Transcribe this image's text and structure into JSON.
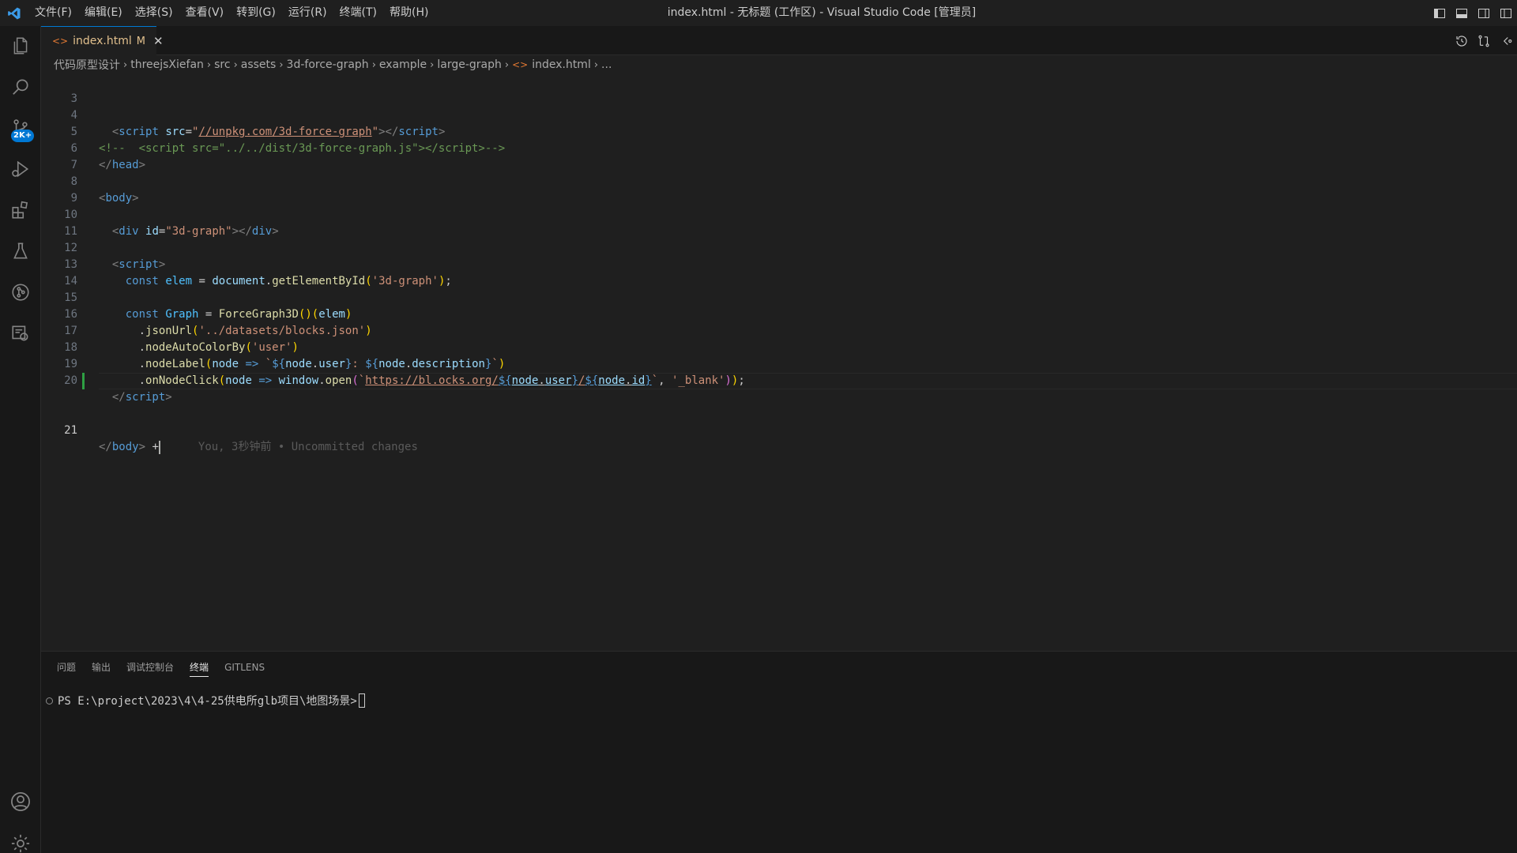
{
  "window": {
    "title": "index.html - 无标题 (工作区) - Visual Studio Code [管理员]"
  },
  "menu": [
    "文件(F)",
    "编辑(E)",
    "选择(S)",
    "查看(V)",
    "转到(G)",
    "运行(R)",
    "终端(T)",
    "帮助(H)"
  ],
  "activity_bar": {
    "scm_badge": "2K+"
  },
  "tab": {
    "label": "index.html",
    "modified": "M",
    "close": "✕"
  },
  "breadcrumb": [
    "代码原型设计",
    "threejsXiefan",
    "src",
    "assets",
    "3d-force-graph",
    "example",
    "large-graph",
    "index.html",
    "..."
  ],
  "editor": {
    "line_numbers": [
      "3",
      "4",
      "5",
      "6",
      "7",
      "8",
      "9",
      "10",
      "11",
      "12",
      "13",
      "14",
      "15",
      "16",
      "17",
      "18",
      "19",
      "20",
      "21"
    ],
    "inline_blame": "You, 3秒钟前 • Uncommitted changes"
  },
  "panel": {
    "tabs": [
      "问题",
      "输出",
      "调试控制台",
      "终端",
      "GITLENS"
    ],
    "active_tab": "终端",
    "terminal_prompt": "PS E:\\project\\2023\\4\\4-25供电所glb项目\\地图场景>"
  },
  "colors": {
    "accent": "#0078d4",
    "modified_file": "#e2c08d",
    "git_added": "#2ea043"
  }
}
